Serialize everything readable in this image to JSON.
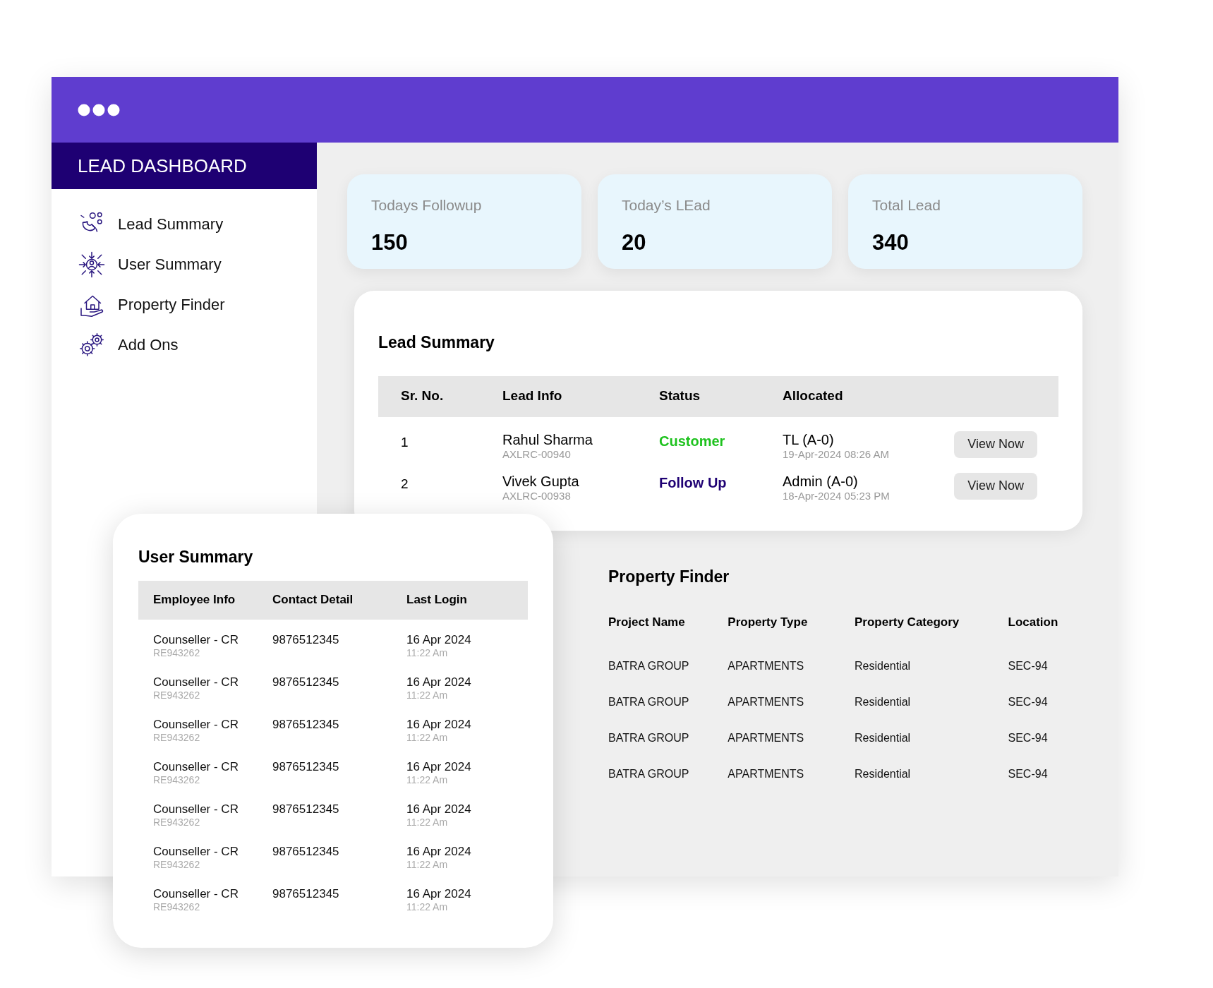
{
  "sidebar": {
    "title": "LEAD DASHBOARD",
    "items": [
      {
        "label": "Lead Summary"
      },
      {
        "label": "User Summary"
      },
      {
        "label": "Property Finder"
      },
      {
        "label": "Add Ons"
      }
    ]
  },
  "stats": [
    {
      "label": "Todays Followup",
      "value": "150"
    },
    {
      "label": "Today’s LEad",
      "value": "20"
    },
    {
      "label": "Total Lead",
      "value": "340"
    }
  ],
  "lead_summary": {
    "title": "Lead Summary",
    "columns": [
      "Sr. No.",
      "Lead Info",
      "Status",
      "Allocated"
    ],
    "rows": [
      {
        "sr": "1",
        "name": "Rahul Sharma",
        "code": "AXLRC-00940",
        "status": "Customer",
        "color": "#1ec21e",
        "allocated": "TL (A-0)",
        "date": "19-Apr-2024 08:26 AM",
        "action": "View Now"
      },
      {
        "sr": "2",
        "name": "Vivek Gupta",
        "code": "AXLRC-00938",
        "status": "Follow Up",
        "color": "#1e0073",
        "allocated": "Admin (A-0)",
        "date": "18-Apr-2024 05:23 PM",
        "action": "View Now"
      }
    ]
  },
  "property_finder": {
    "title": "Property Finder",
    "columns": [
      "Project Name",
      "Property Type",
      "Property Category",
      "Location"
    ],
    "rows": [
      [
        "BATRA GROUP",
        "APARTMENTS",
        "Residential",
        "SEC-94"
      ],
      [
        "BATRA GROUP",
        "APARTMENTS",
        "Residential",
        "SEC-94"
      ],
      [
        "BATRA GROUP",
        "APARTMENTS",
        "Residential",
        "SEC-94"
      ],
      [
        "BATRA GROUP",
        "APARTMENTS",
        "Residential",
        "SEC-94"
      ]
    ]
  },
  "user_summary": {
    "title": "User Summary",
    "columns": [
      "Employee Info",
      "Contact Detail",
      "Last Login"
    ],
    "rows": [
      {
        "role": "Counseller - CR",
        "id": "RE943262",
        "contact": "9876512345",
        "date": "16 Apr 2024",
        "time": "11:22 Am"
      },
      {
        "role": "Counseller - CR",
        "id": "RE943262",
        "contact": "9876512345",
        "date": "16 Apr 2024",
        "time": "11:22 Am"
      },
      {
        "role": "Counseller - CR",
        "id": "RE943262",
        "contact": "9876512345",
        "date": "16 Apr 2024",
        "time": "11:22 Am"
      },
      {
        "role": "Counseller - CR",
        "id": "RE943262",
        "contact": "9876512345",
        "date": "16 Apr 2024",
        "time": "11:22 Am"
      },
      {
        "role": "Counseller - CR",
        "id": "RE943262",
        "contact": "9876512345",
        "date": "16 Apr 2024",
        "time": "11:22 Am"
      },
      {
        "role": "Counseller - CR",
        "id": "RE943262",
        "contact": "9876512345",
        "date": "16 Apr 2024",
        "time": "11:22 Am"
      },
      {
        "role": "Counseller - CR",
        "id": "RE943262",
        "contact": "9876512345",
        "date": "16 Apr 2024",
        "time": "11:22 Am"
      }
    ]
  }
}
